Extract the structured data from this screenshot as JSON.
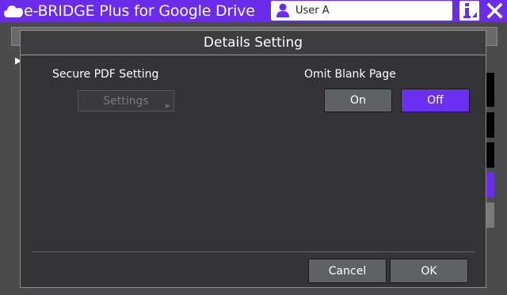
{
  "window": {
    "title": "e-BRIDGE Plus for Google Drive",
    "user": "User A",
    "info_glyph": "i",
    "close_glyph": "✕"
  },
  "dialog": {
    "title": "Details Setting",
    "secure_pdf": {
      "label": "Secure PDF Setting",
      "settings_button": "Settings",
      "settings_enabled": false
    },
    "omit_blank": {
      "label": "Omit Blank Page",
      "options": [
        "On",
        "Off"
      ],
      "selected": "Off"
    },
    "footer": {
      "cancel": "Cancel",
      "ok": "OK"
    }
  },
  "colors": {
    "accent": "#6b2ff2",
    "titlebar": "#6a2bea",
    "dialog_bg": "#343436"
  },
  "icons": {
    "app": "cloud-icon",
    "user": "user-icon",
    "info": "info-icon",
    "close": "close-icon"
  }
}
